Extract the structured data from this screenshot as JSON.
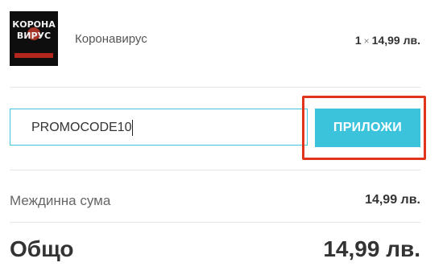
{
  "product": {
    "cover_title_line1": "КОРОНА",
    "cover_title_line2": "ВИРУС",
    "name": "Коронавирус",
    "quantity": "1",
    "times_symbol": "×",
    "price": "14,99 лв."
  },
  "coupon": {
    "value": "PROMOCODE10",
    "apply_label": "ПРИЛОЖИ"
  },
  "totals": {
    "subtotal_label": "Междинна сума",
    "subtotal_value": "14,99 лв.",
    "total_label": "Общо",
    "total_value": "14,99 лв."
  },
  "colors": {
    "accent": "#3cc3dc",
    "highlight": "#e0341c"
  }
}
